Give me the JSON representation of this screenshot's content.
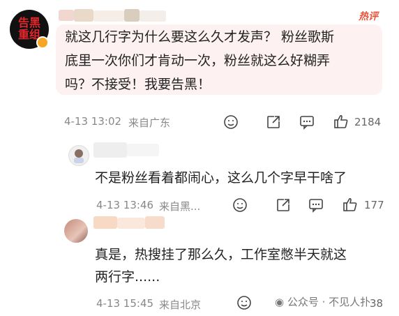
{
  "comment1": {
    "avatar_text_top": "告黑",
    "avatar_text_bottom": "重组",
    "hot_label": "热评",
    "line1": "就这几行字为什么要这么久才发声？ 粉丝歌斯",
    "line2": "底里一次你们才肯动一次，粉丝就这么好糊弄",
    "line3": "吗？不接受！我要告黑！",
    "timestamp": "4-13 13:02",
    "location": "来自广东",
    "like_count": "2184"
  },
  "reply1": {
    "text": "不是粉丝看着都闹心，这么几个字早干啥了",
    "timestamp": "4-13 13:46",
    "location": "来自黑...",
    "like_count": "177"
  },
  "reply2": {
    "line1": "真是，热搜挂了那么久，工作室憋半天就这",
    "line2": "两行字......",
    "timestamp": "4-13 15:45",
    "location": "来自北京",
    "like_count": "38"
  },
  "watermark": "公众号 · 不见人扑",
  "colors": {
    "accent_red": "#e3262b",
    "hot_orange": "#e8543e",
    "bubble_bg": "#fdf1f1",
    "meta_gray": "#888888"
  },
  "icons": [
    "emoji-icon",
    "repost-icon",
    "comment-icon",
    "like-icon"
  ]
}
